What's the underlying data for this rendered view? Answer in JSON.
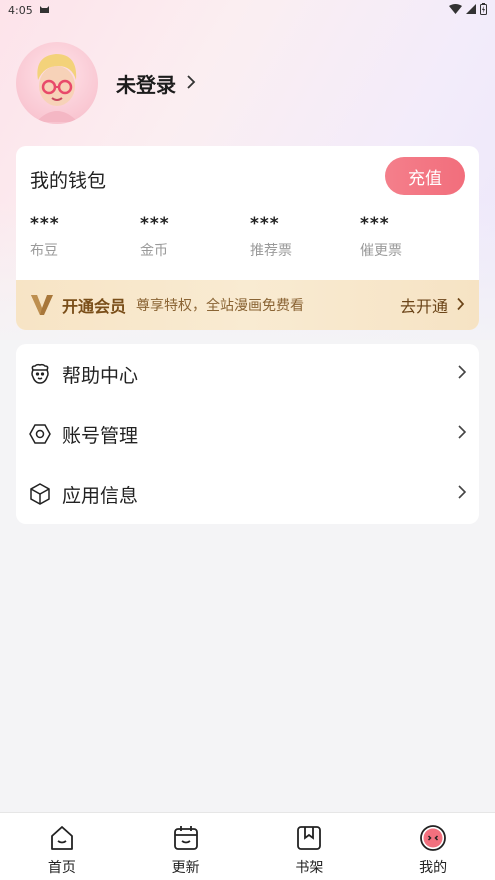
{
  "status_bar": {
    "time": "4:05"
  },
  "profile": {
    "login_label": "未登录"
  },
  "wallet": {
    "title": "我的钱包",
    "recharge_label": "充值",
    "stats": [
      {
        "value": "***",
        "label": "布豆"
      },
      {
        "value": "***",
        "label": "金币"
      },
      {
        "value": "***",
        "label": "推荐票"
      },
      {
        "value": "***",
        "label": "催更票"
      }
    ],
    "vip": {
      "title": "开通会员",
      "desc": "尊享特权，全站漫画免费看",
      "action": "去开通"
    }
  },
  "menu": [
    {
      "label": "帮助中心",
      "icon": "help-center-icon"
    },
    {
      "label": "账号管理",
      "icon": "account-hexagon-icon"
    },
    {
      "label": "应用信息",
      "icon": "app-info-cube-icon"
    }
  ],
  "tabs": [
    {
      "label": "首页",
      "icon": "home-icon"
    },
    {
      "label": "更新",
      "icon": "calendar-icon"
    },
    {
      "label": "书架",
      "icon": "bookshelf-icon"
    },
    {
      "label": "我的",
      "icon": "profile-face-icon",
      "active": true
    }
  ],
  "colors": {
    "accent": "#f2707e",
    "vip_text": "#7a4e19",
    "vip_bg": "#f7e4c5"
  }
}
